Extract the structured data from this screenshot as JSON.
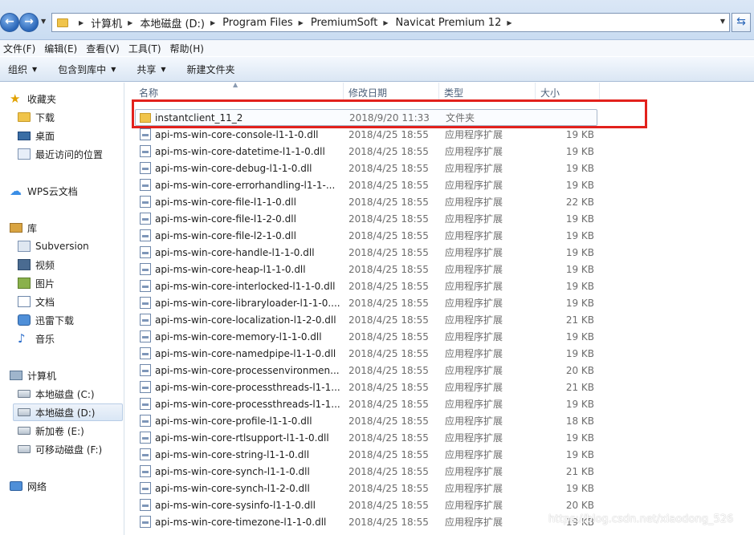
{
  "breadcrumb": [
    "计算机",
    "本地磁盘 (D:)",
    "Program Files",
    "PremiumSoft",
    "Navicat Premium 12"
  ],
  "menu": [
    "文件(F)",
    "编辑(E)",
    "查看(V)",
    "工具(T)",
    "帮助(H)"
  ],
  "toolbar": {
    "organize": "组织",
    "include_library": "包含到库中",
    "share": "共享",
    "new_folder": "新建文件夹"
  },
  "nav": {
    "favorites": "收藏夹",
    "downloads": "下载",
    "desktop": "桌面",
    "recent": "最近访问的位置",
    "wps": "WPS云文档",
    "libraries": "库",
    "subversion": "Subversion",
    "videos": "视频",
    "pictures": "图片",
    "documents": "文档",
    "xunlei": "迅雷下载",
    "music": "音乐",
    "computer": "计算机",
    "drive_c": "本地磁盘 (C:)",
    "drive_d": "本地磁盘 (D:)",
    "drive_e": "新加卷 (E:)",
    "drive_f": "可移动磁盘 (F:)",
    "network": "网络"
  },
  "columns": {
    "name": "名称",
    "date": "修改日期",
    "type": "类型",
    "size": "大小"
  },
  "files": [
    {
      "name": "instantclient_11_2",
      "date": "2018/9/20 11:33",
      "type": "文件夹",
      "size": "",
      "kind": "folder"
    },
    {
      "name": "api-ms-win-core-console-l1-1-0.dll",
      "date": "2018/4/25 18:55",
      "type": "应用程序扩展",
      "size": "19 KB",
      "kind": "dll"
    },
    {
      "name": "api-ms-win-core-datetime-l1-1-0.dll",
      "date": "2018/4/25 18:55",
      "type": "应用程序扩展",
      "size": "19 KB",
      "kind": "dll"
    },
    {
      "name": "api-ms-win-core-debug-l1-1-0.dll",
      "date": "2018/4/25 18:55",
      "type": "应用程序扩展",
      "size": "19 KB",
      "kind": "dll"
    },
    {
      "name": "api-ms-win-core-errorhandling-l1-1-...",
      "date": "2018/4/25 18:55",
      "type": "应用程序扩展",
      "size": "19 KB",
      "kind": "dll"
    },
    {
      "name": "api-ms-win-core-file-l1-1-0.dll",
      "date": "2018/4/25 18:55",
      "type": "应用程序扩展",
      "size": "22 KB",
      "kind": "dll"
    },
    {
      "name": "api-ms-win-core-file-l1-2-0.dll",
      "date": "2018/4/25 18:55",
      "type": "应用程序扩展",
      "size": "19 KB",
      "kind": "dll"
    },
    {
      "name": "api-ms-win-core-file-l2-1-0.dll",
      "date": "2018/4/25 18:55",
      "type": "应用程序扩展",
      "size": "19 KB",
      "kind": "dll"
    },
    {
      "name": "api-ms-win-core-handle-l1-1-0.dll",
      "date": "2018/4/25 18:55",
      "type": "应用程序扩展",
      "size": "19 KB",
      "kind": "dll"
    },
    {
      "name": "api-ms-win-core-heap-l1-1-0.dll",
      "date": "2018/4/25 18:55",
      "type": "应用程序扩展",
      "size": "19 KB",
      "kind": "dll"
    },
    {
      "name": "api-ms-win-core-interlocked-l1-1-0.dll",
      "date": "2018/4/25 18:55",
      "type": "应用程序扩展",
      "size": "19 KB",
      "kind": "dll"
    },
    {
      "name": "api-ms-win-core-libraryloader-l1-1-0....",
      "date": "2018/4/25 18:55",
      "type": "应用程序扩展",
      "size": "19 KB",
      "kind": "dll"
    },
    {
      "name": "api-ms-win-core-localization-l1-2-0.dll",
      "date": "2018/4/25 18:55",
      "type": "应用程序扩展",
      "size": "21 KB",
      "kind": "dll"
    },
    {
      "name": "api-ms-win-core-memory-l1-1-0.dll",
      "date": "2018/4/25 18:55",
      "type": "应用程序扩展",
      "size": "19 KB",
      "kind": "dll"
    },
    {
      "name": "api-ms-win-core-namedpipe-l1-1-0.dll",
      "date": "2018/4/25 18:55",
      "type": "应用程序扩展",
      "size": "19 KB",
      "kind": "dll"
    },
    {
      "name": "api-ms-win-core-processenvironmen...",
      "date": "2018/4/25 18:55",
      "type": "应用程序扩展",
      "size": "20 KB",
      "kind": "dll"
    },
    {
      "name": "api-ms-win-core-processthreads-l1-1...",
      "date": "2018/4/25 18:55",
      "type": "应用程序扩展",
      "size": "21 KB",
      "kind": "dll"
    },
    {
      "name": "api-ms-win-core-processthreads-l1-1...",
      "date": "2018/4/25 18:55",
      "type": "应用程序扩展",
      "size": "19 KB",
      "kind": "dll"
    },
    {
      "name": "api-ms-win-core-profile-l1-1-0.dll",
      "date": "2018/4/25 18:55",
      "type": "应用程序扩展",
      "size": "18 KB",
      "kind": "dll"
    },
    {
      "name": "api-ms-win-core-rtlsupport-l1-1-0.dll",
      "date": "2018/4/25 18:55",
      "type": "应用程序扩展",
      "size": "19 KB",
      "kind": "dll"
    },
    {
      "name": "api-ms-win-core-string-l1-1-0.dll",
      "date": "2018/4/25 18:55",
      "type": "应用程序扩展",
      "size": "19 KB",
      "kind": "dll"
    },
    {
      "name": "api-ms-win-core-synch-l1-1-0.dll",
      "date": "2018/4/25 18:55",
      "type": "应用程序扩展",
      "size": "21 KB",
      "kind": "dll"
    },
    {
      "name": "api-ms-win-core-synch-l1-2-0.dll",
      "date": "2018/4/25 18:55",
      "type": "应用程序扩展",
      "size": "19 KB",
      "kind": "dll"
    },
    {
      "name": "api-ms-win-core-sysinfo-l1-1-0.dll",
      "date": "2018/4/25 18:55",
      "type": "应用程序扩展",
      "size": "20 KB",
      "kind": "dll"
    },
    {
      "name": "api-ms-win-core-timezone-l1-1-0.dll",
      "date": "2018/4/25 18:55",
      "type": "应用程序扩展",
      "size": "19 KB",
      "kind": "dll"
    }
  ],
  "watermark": "https://blog.csdn.net/xiaodong_526",
  "colors": {
    "highlight_box": "#e2211c",
    "accent": "#2a66b8"
  }
}
